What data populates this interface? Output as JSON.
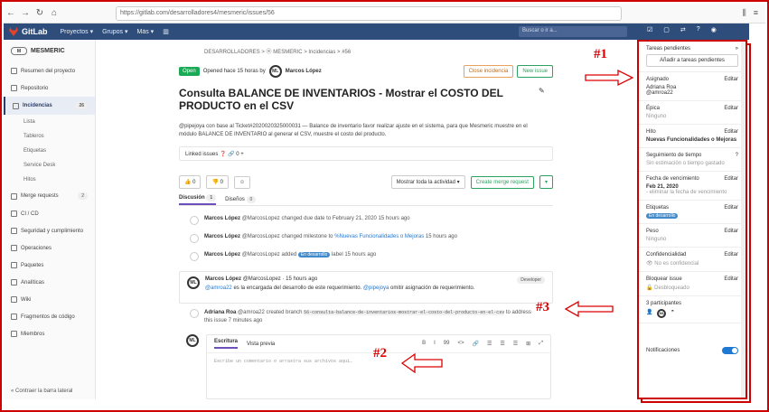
{
  "browser": {
    "url": "https://gitlab.com/desarrolladores4/mesmeric/issues/56"
  },
  "topbar": {
    "logo": "GitLab",
    "menu": [
      "Proyectos ▾",
      "Grupos ▾",
      "Más ▾"
    ],
    "search_placeholder": "Buscar o ir a..."
  },
  "sidebar": {
    "project": "MESMERIC",
    "project_avatar": "M",
    "items": [
      {
        "label": "Resumen del proyecto"
      },
      {
        "label": "Repositorio"
      },
      {
        "label": "Incidencias",
        "count": "26"
      },
      {
        "label": "Merge requests",
        "count": "2"
      },
      {
        "label": "CI / CD"
      },
      {
        "label": "Seguridad y cumplimiento"
      },
      {
        "label": "Operaciones"
      },
      {
        "label": "Paquetes"
      },
      {
        "label": "Analíticas"
      },
      {
        "label": "Wiki"
      },
      {
        "label": "Fragmentos de código"
      },
      {
        "label": "Miembros"
      }
    ],
    "subitems": [
      "Lista",
      "Tableros",
      "Etiquetas",
      "Service Desk",
      "Hitos"
    ],
    "collapse": "« Contraer la barra lateral"
  },
  "main": {
    "breadcrumb": "DESARROLLADORES > ⓜ MESMERIC > Incidencias > #56",
    "status": "Open",
    "opened": "Opened hace 15 horas by",
    "author": "Marcos López",
    "close_btn": "Close incidencia",
    "new_btn": "New issue",
    "title": "Consulta BALANCE DE INVENTARIOS - Mostrar el COSTO DEL PRODUCTO en el CSV",
    "description": "@pipejoya con base al Ticket#2020020325000031 — Balance de inventario favor realizar ajuste en el sistema, para que Mesmeric muestre en el módulo BALANCE DE INVENTARIO al generar el CSV, muestre el costo del producto.",
    "linked": "Linked issues ❓  🔗 0  +",
    "thumbs_up": "0",
    "thumbs_down": "0",
    "smiley": "☺",
    "activity_select": "Mostrar toda la actividad ▾",
    "create_mr": "Create merge request",
    "tabs": [
      {
        "label": "Discusión",
        "count": "1"
      },
      {
        "label": "Diseños",
        "count": "0"
      }
    ],
    "events": [
      {
        "user": "Marcos López",
        "handle": "@MarcosLopez",
        "text": "changed due date to February 21, 2020 15 hours ago"
      },
      {
        "user": "Marcos López",
        "handle": "@MarcosLopez",
        "text": "changed milestone to",
        "link": "%Nuevas Funcionalidades o Mejoras",
        "tail": "15 hours ago"
      },
      {
        "user": "Marcos López",
        "handle": "@MarcosLopez",
        "text": "added",
        "label": "En desarrollo",
        "tail": "label 15 hours ago"
      }
    ],
    "comment": {
      "user": "Marcos López",
      "handle": "@MarcosLopez · 15 hours ago",
      "role": "Developer",
      "body_link": "@amroa22",
      "body": "es la encargada del desarrollo de este requerimiento.",
      "body_link2": "@pipejoya",
      "body2": "omitir asignación de requerimiento.",
      "avatar": "ML"
    },
    "branch_event": {
      "user": "Adriana Roa",
      "handle": "@amroa22 created branch",
      "branch": "56-consulta-balance-de-inventarios-mostrar-el-costo-del-producto-en-el-csv",
      "tail": "to address this issue 7 minutes ago"
    },
    "editor": {
      "tab_write": "Escritura",
      "tab_preview": "Vista previa",
      "placeholder": "Escribe un comentario o arrastra sus archivos aquí…",
      "tools": [
        "B",
        "I",
        "99",
        "<>",
        "🔗",
        "☰",
        "☰",
        "☰",
        "⊞",
        "⤢"
      ]
    }
  },
  "right": {
    "todo": "Tareas pendientes",
    "add_todo": "Añadir a tareas pendientes",
    "sections": [
      {
        "h": "Asignado",
        "edit": "Editar",
        "v": "Adriana Roa",
        "v2": "@amroa22"
      },
      {
        "h": "Épica",
        "edit": "Editar",
        "v": "Ninguno"
      },
      {
        "h": "Hito",
        "edit": "Editar",
        "vb": "Nuevas Funcionalidades o Mejoras"
      },
      {
        "h": "Seguimiento de tiempo",
        "edit": "?",
        "v": "Sin estimación o tiempo gastado"
      },
      {
        "h": "Fecha de vencimiento",
        "edit": "Editar",
        "vb": "Feb 21, 2020",
        "v": "- eliminar la fecha de vencimiento"
      },
      {
        "h": "Etiquetas",
        "edit": "Editar",
        "label": "En desarrollo"
      },
      {
        "h": "Peso",
        "edit": "Editar",
        "v": "Ninguno"
      },
      {
        "h": "Confidencialidad",
        "edit": "Editar",
        "v": "👁 No es confidencial"
      },
      {
        "h": "Bloquear issue",
        "edit": "Editar",
        "v": "🔓 Desbloqueado"
      },
      {
        "h": "3 participantes",
        "edit": ""
      },
      {
        "h": "Notificaciones",
        "edit": ""
      }
    ]
  },
  "annotations": {
    "a1": "#1",
    "a2": "#2",
    "a3": "#3"
  }
}
